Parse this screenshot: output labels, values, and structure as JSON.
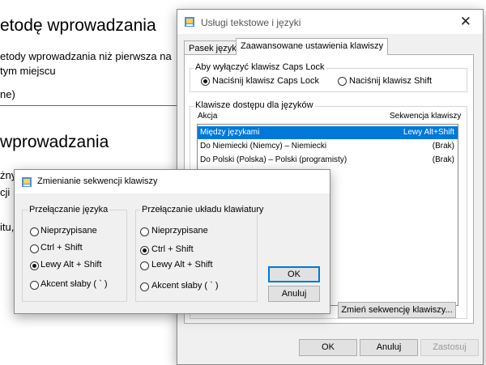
{
  "background": {
    "heading1": "etodę wprowadzania",
    "line1": "etody wprowadzania niż pierwsza na",
    "line2": " tym miejscu",
    "line3": "ne)",
    "heading2": "wprowadzania",
    "frag1": "żny",
    "frag2": "cji",
    "frag3": "itu,"
  },
  "main_dialog": {
    "title": "Usługi tekstowe i języki",
    "tabs": [
      "Pasek języka",
      "Zaawansowane ustawienia klawiszy"
    ],
    "capslock_group": {
      "label": "Aby wyłączyć klawisz Caps Lock",
      "options": [
        "Naciśnij klawisz Caps Lock",
        "Naciśnij klawisz Shift"
      ],
      "selected": 0
    },
    "hotkeys_group": {
      "label": "Klawisze dostępu dla języków",
      "col_action": "Akcja",
      "col_sequence": "Sekwencja klawiszy",
      "rows": [
        {
          "action": "Między językami",
          "sequence": "Lewy Alt+Shift",
          "selected": true
        },
        {
          "action": "Do Niemiecki (Niemcy) – Niemiecki",
          "sequence": "(Brak)",
          "selected": false
        },
        {
          "action": "Do Polski (Polska) – Polski (programisty)",
          "sequence": "(Brak)",
          "selected": false
        }
      ],
      "change_button": "Zmień sekwencję klawiszy..."
    },
    "buttons": {
      "ok": "OK",
      "cancel": "Anuluj",
      "apply": "Zastosuj"
    }
  },
  "change_dialog": {
    "title": "Zmienianie sekwencji klawiszy",
    "lang_group": {
      "label": "Przełączanie języka",
      "options": [
        "Nieprzypisane",
        "Ctrl + Shift",
        "Lewy Alt + Shift",
        "Akcent słaby ( ` )"
      ],
      "selected": 2
    },
    "layout_group": {
      "label": "Przełączanie układu klawiatury",
      "options": [
        "Nieprzypisane",
        "Ctrl + Shift",
        "Lewy Alt + Shift",
        "Akcent słaby ( ` )"
      ],
      "selected": 1
    },
    "buttons": {
      "ok": "OK",
      "cancel": "Anuluj"
    }
  },
  "colors": {
    "selection": "#0078d7",
    "dialog_bg": "#f0f0f0"
  },
  "icons": {
    "window_icon": "text-services-icon",
    "close": "close-icon"
  }
}
